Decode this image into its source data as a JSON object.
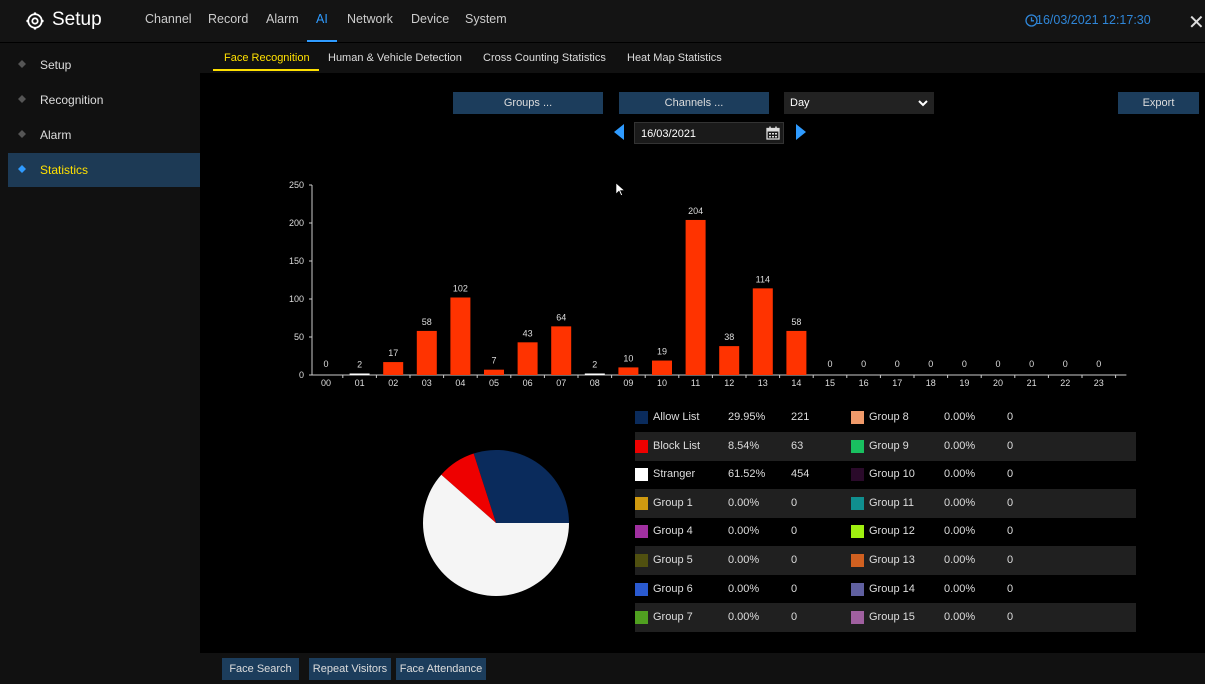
{
  "header": {
    "title": "Setup",
    "nav": [
      "Channel",
      "Record",
      "Alarm",
      "AI",
      "Network",
      "Device",
      "System"
    ],
    "active_nav": "AI",
    "datetime": "16/03/2021 12:17:30"
  },
  "sidebar": {
    "items": [
      {
        "label": "Setup"
      },
      {
        "label": "Recognition"
      },
      {
        "label": "Alarm"
      },
      {
        "label": "Statistics"
      }
    ]
  },
  "tabs": [
    "Face Recognition",
    "Human & Vehicle Detection",
    "Cross Counting Statistics",
    "Heat Map Statistics"
  ],
  "controls": {
    "groups_label": "Groups ...",
    "channels_label": "Channels ...",
    "period_value": "Day",
    "export_label": "Export",
    "date_value": "16/03/2021"
  },
  "chart_data": {
    "type": "bar",
    "categories": [
      "00",
      "01",
      "02",
      "03",
      "04",
      "05",
      "06",
      "07",
      "08",
      "09",
      "10",
      "11",
      "12",
      "13",
      "14",
      "15",
      "16",
      "17",
      "18",
      "19",
      "20",
      "21",
      "22",
      "23"
    ],
    "values": [
      0,
      2,
      17,
      58,
      102,
      7,
      43,
      64,
      2,
      10,
      19,
      204,
      38,
      114,
      58,
      0,
      0,
      0,
      0,
      0,
      0,
      0,
      0,
      0
    ],
    "ylim": [
      0,
      250
    ],
    "yticks": [
      0,
      50,
      100,
      150,
      200,
      250
    ],
    "bar_color": "#ff3300",
    "small_bar_color": "#ffffff"
  },
  "pie_data": {
    "type": "pie",
    "slices": [
      {
        "name": "Allow List",
        "percent": 29.95,
        "color": "#0a2b5c"
      },
      {
        "name": "Block List",
        "percent": 8.54,
        "color": "#ee0000"
      },
      {
        "name": "Stranger",
        "percent": 61.52,
        "color": "#f5f5f5"
      }
    ]
  },
  "legend": [
    [
      {
        "name": "Allow List",
        "pct": "29.95%",
        "count": "221",
        "color": "#0a2b5c"
      },
      {
        "name": "Group  8",
        "pct": "0.00%",
        "count": "0",
        "color": "#f09a6a"
      }
    ],
    [
      {
        "name": "Block List",
        "pct": "8.54%",
        "count": "63",
        "color": "#ee0000"
      },
      {
        "name": "Group  9",
        "pct": "0.00%",
        "count": "0",
        "color": "#19c060"
      }
    ],
    [
      {
        "name": "Stranger",
        "pct": "61.52%",
        "count": "454",
        "color": "#ffffff"
      },
      {
        "name": "Group  10",
        "pct": "0.00%",
        "count": "0",
        "color": "#2a0a2a"
      }
    ],
    [
      {
        "name": "Group  1",
        "pct": "0.00%",
        "count": "0",
        "color": "#d09a10"
      },
      {
        "name": "Group  11",
        "pct": "0.00%",
        "count": "0",
        "color": "#108f8f"
      }
    ],
    [
      {
        "name": "Group  4",
        "pct": "0.00%",
        "count": "0",
        "color": "#a030a0"
      },
      {
        "name": "Group  12",
        "pct": "0.00%",
        "count": "0",
        "color": "#a0f010"
      }
    ],
    [
      {
        "name": "Group  5",
        "pct": "0.00%",
        "count": "0",
        "color": "#505010"
      },
      {
        "name": "Group  13",
        "pct": "0.00%",
        "count": "0",
        "color": "#d06020"
      }
    ],
    [
      {
        "name": "Group  6",
        "pct": "0.00%",
        "count": "0",
        "color": "#2a5ad0"
      },
      {
        "name": "Group  14",
        "pct": "0.00%",
        "count": "0",
        "color": "#6060a0"
      }
    ],
    [
      {
        "name": "Group  7",
        "pct": "0.00%",
        "count": "0",
        "color": "#50a020"
      },
      {
        "name": "Group  15",
        "pct": "0.00%",
        "count": "0",
        "color": "#a060a0"
      }
    ]
  ],
  "footer": {
    "buttons": [
      "Face Search",
      "Repeat Visitors",
      "Face Attendance"
    ]
  }
}
